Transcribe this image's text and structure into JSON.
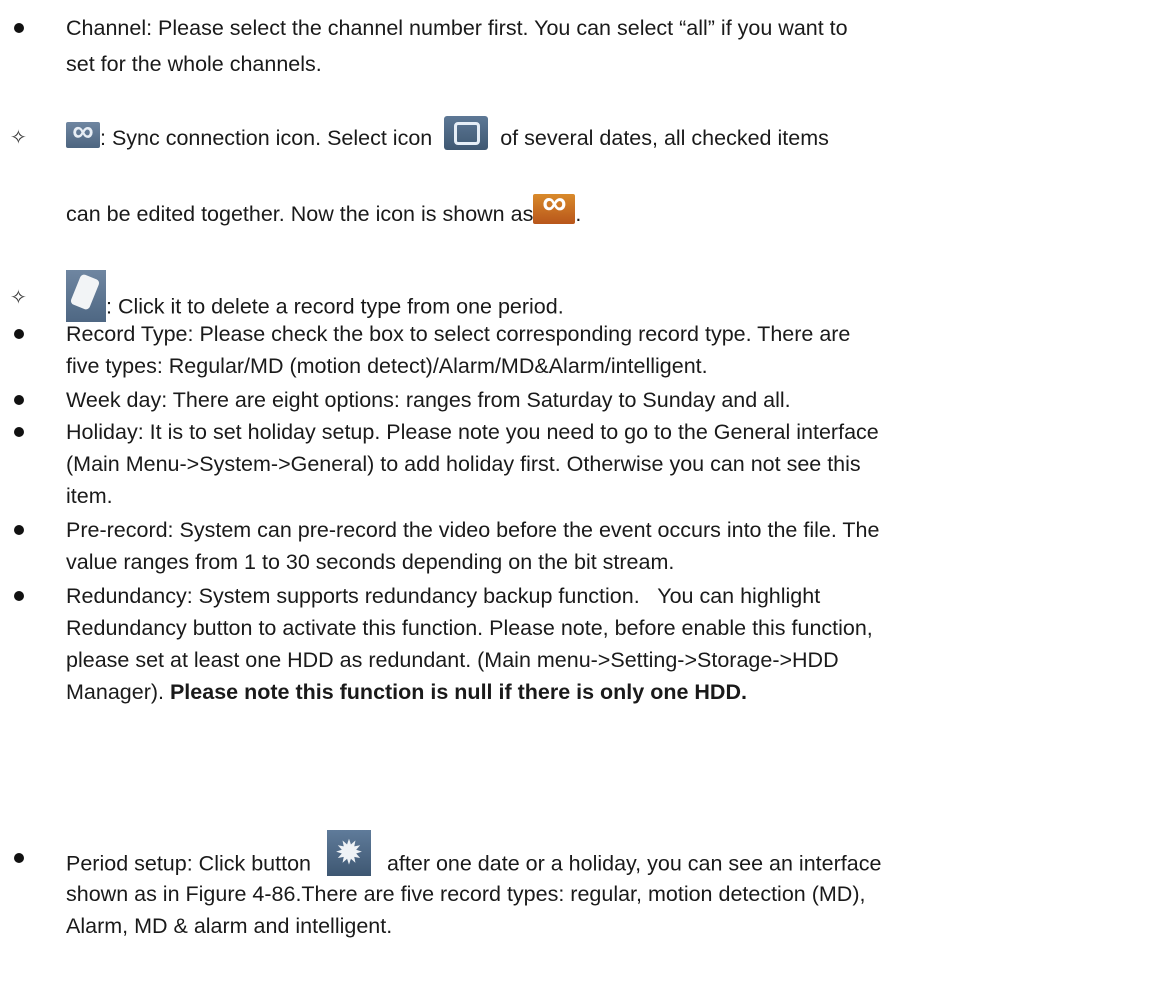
{
  "channel": {
    "text_l1": "Channel: Please select the channel number first. You can select “all” if you want to",
    "text_l2": "set for the whole channels."
  },
  "sync": {
    "icon_gray": "link-icon",
    "text_a": ": Sync connection icon. Select icon",
    "icon_square": "square-icon",
    "text_b": "of several dates, all checked items",
    "text_l2": "can be edited together. Now the icon is shown as",
    "icon_orange": "link-icon-orange",
    "text_end": "."
  },
  "erase": {
    "icon": "eraser-icon",
    "text": ": Click it to delete a record type from one period."
  },
  "record_type": {
    "l1": "Record Type: Please check the box to select corresponding record type. There are",
    "l2": "five types: Regular/MD (motion detect)/Alarm/MD&Alarm/intelligent."
  },
  "week_day": {
    "l1": "Week day: There are eight options: ranges from Saturday to Sunday and all."
  },
  "holiday": {
    "l1": "Holiday: It is to set holiday setup. Please note you need to go to the General interface",
    "l2": "(Main Menu->System->General) to add holiday first. Otherwise you can not see this",
    "l3": "item."
  },
  "pre_record": {
    "l1": "Pre-record: System can pre-record the video before the event occurs into the file. The",
    "l2": "value ranges from 1 to 30 seconds depending on the bit stream."
  },
  "redundancy": {
    "l1": "Redundancy: System supports redundancy backup function.   You can highlight",
    "l2": "Redundancy button to activate this function. Please note, before enable this function,",
    "l3": "please set at least one HDD as redundant. (Main menu->Setting->Storage->HDD",
    "l4a": "Manager). ",
    "l4b": "Please note this function is null if there is only one HDD."
  },
  "period": {
    "text_a": "Period setup: Click button",
    "icon": "gear-icon",
    "text_b": "after one date or a holiday, you can see an interface",
    "l2": "shown as in Figure 4-86.There are five record types: regular, motion detection (MD),",
    "l3": "Alarm, MD & alarm and intelligent."
  }
}
